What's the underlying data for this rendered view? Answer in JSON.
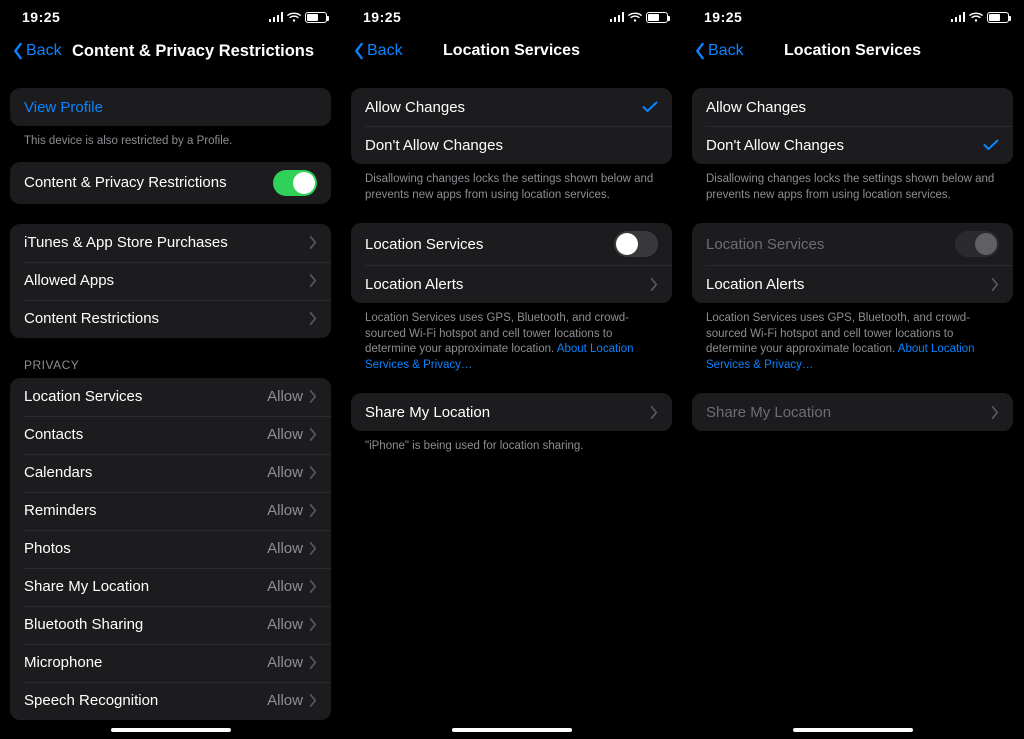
{
  "time": "19:25",
  "screen1": {
    "back": "Back",
    "title": "Content & Privacy Restrictions",
    "view_profile": "View Profile",
    "profile_footer": "This device is also restricted by a Profile.",
    "cp_toggle_label": "Content & Privacy Restrictions",
    "g3": {
      "itunes": "iTunes & App Store Purchases",
      "allowed_apps": "Allowed Apps",
      "content_restrictions": "Content Restrictions"
    },
    "privacy_header": "Privacy",
    "privacy": [
      {
        "label": "Location Services",
        "value": "Allow"
      },
      {
        "label": "Contacts",
        "value": "Allow"
      },
      {
        "label": "Calendars",
        "value": "Allow"
      },
      {
        "label": "Reminders",
        "value": "Allow"
      },
      {
        "label": "Photos",
        "value": "Allow"
      },
      {
        "label": "Share My Location",
        "value": "Allow"
      },
      {
        "label": "Bluetooth Sharing",
        "value": "Allow"
      },
      {
        "label": "Microphone",
        "value": "Allow"
      },
      {
        "label": "Speech Recognition",
        "value": "Allow"
      }
    ]
  },
  "screen2": {
    "back": "Back",
    "title": "Location Services",
    "allow": "Allow Changes",
    "dont_allow": "Don't Allow Changes",
    "changes_footer": "Disallowing changes locks the settings shown below and prevents new apps from using location services.",
    "loc_services": "Location Services",
    "loc_alerts": "Location Alerts",
    "loc_footer_text": "Location Services uses GPS, Bluetooth, and crowd-sourced Wi-Fi hotspot and cell tower locations to determine your approximate location. ",
    "loc_footer_link": "About Location Services & Privacy…",
    "share": "Share My Location",
    "share_footer": "\"iPhone\" is being used for location sharing."
  },
  "screen3": {
    "back": "Back",
    "title": "Location Services",
    "allow": "Allow Changes",
    "dont_allow": "Don't Allow Changes",
    "changes_footer": "Disallowing changes locks the settings shown below and prevents new apps from using location services.",
    "loc_services": "Location Services",
    "loc_alerts": "Location Alerts",
    "loc_footer_text": "Location Services uses GPS, Bluetooth, and crowd-sourced Wi-Fi hotspot and cell tower locations to determine your approximate location. ",
    "loc_footer_link": "About Location Services & Privacy…",
    "share": "Share My Location"
  }
}
